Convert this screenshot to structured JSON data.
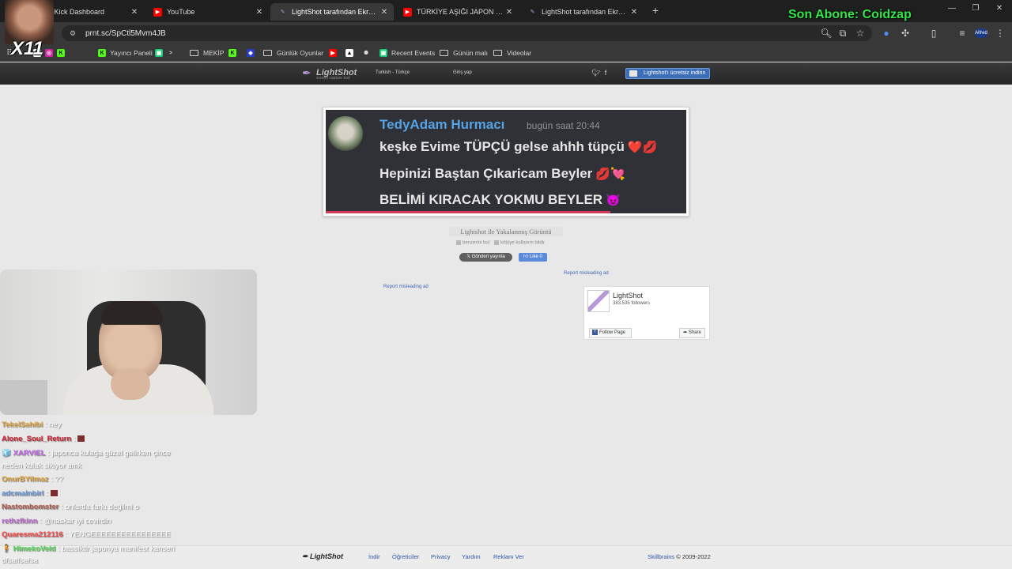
{
  "browser": {
    "tabs": [
      {
        "label": "m - Kick Dashboard",
        "favicon_color": "#53fc18"
      },
      {
        "label": "YouTube",
        "favicon_color": "#ff0000"
      },
      {
        "label": "LightShot tarafından Ekran Gör",
        "favicon_color": "#9b7bc9",
        "active": true
      },
      {
        "label": "TÜRKİYE AŞIĞI JAPON KADINL/",
        "favicon_color": "#ff0000"
      },
      {
        "label": "LightShot tarafından Ekran Gör",
        "favicon_color": "#9b7bc9"
      }
    ],
    "new_tab": "+",
    "window_controls": {
      "minimize": "—",
      "maximize": "❐",
      "close": "✕"
    },
    "address_url": "prnt.sc/SpCtl5Mvm4JB",
    "bookmarks": [
      {
        "label": "Yayıncı Paneli",
        "icon_color": "#53fc18"
      },
      {
        "label": "MEKİP",
        "icon_color": "#cfcfcf",
        "folder": true
      },
      {
        "label": "Günlük Oyunlar",
        "folder": true
      },
      {
        "label": "Recent Events",
        "icon_color": "#1ec97a"
      },
      {
        "label": "Günün malı",
        "folder": true
      },
      {
        "label": "Videolar",
        "folder": true
      }
    ],
    "extension_badge": "Alfred"
  },
  "overlay": {
    "subscriber_text": "Son Abone: Coidzap",
    "combo_text": "X11"
  },
  "lightshot": {
    "logo": "LightShot",
    "tagline": "screen capture tool",
    "language": "Turkish - Türkçe",
    "login": "Giriş yap",
    "download_button": "Lightshot'ı ücretsiz indirin",
    "screenshot": {
      "username": "TedyAdam Hurmacı",
      "timestamp": "bugün saat 20:44",
      "lines": [
        {
          "text": "keşke Evime TÜPÇÜ gelse ahhh tüpçü",
          "emoji": "❤️💋"
        },
        {
          "text": "Hepinizi Baştan Çıkaricam Beyler",
          "emoji": "💋💘"
        },
        {
          "text": "BELİMİ KIRACAK YOKMU BEYLER",
          "emoji": "😈"
        }
      ]
    },
    "caption": "Lightshot ile Yakalanmış Görüntü",
    "find_similar": "benzerini bul",
    "report_abuse": "kötüye kullanım bildir",
    "tweet_button": "Gönderi yayınla",
    "like_button": "Like 0",
    "report_ad_left": "Report misleading ad",
    "report_ad_right": "Report misleading ad",
    "fb_widget": {
      "name": "LightShot",
      "followers": "383,535 followers",
      "follow": "Follow Page",
      "share": "Share"
    },
    "footer": {
      "logo": "LightShot",
      "links": [
        "İndir",
        "Öğreticiler",
        "Privacy",
        "Yardım",
        "Reklam Ver"
      ],
      "copyright_brand": "Skillbrains",
      "copyright_rest": " © 2009-2022"
    }
  },
  "chat": [
    {
      "user": "TekelSahibi",
      "color": "#e3a73c",
      "text": ": ney"
    },
    {
      "user": "Alone_Soul_Return",
      "color": "#d11d2d",
      "text": ":",
      "badge": true
    },
    {
      "user": "XARVIEL",
      "color": "#c168e8",
      "text": ": japonca kulağa güzel gelirken çince"
    },
    {
      "user": "",
      "color": "#ffffff",
      "text": "neden kulak sikiyor amk"
    },
    {
      "user": "OnurBYilmaz",
      "color": "#e3a73c",
      "text": ": ??"
    },
    {
      "user": "adcmalnbirl",
      "color": "#6c9bd8",
      "text": ":",
      "badge": true
    },
    {
      "user": "Nastombomster",
      "color": "#b4584b",
      "text": ": onlarda farkı değilmi o"
    },
    {
      "user": "rethzfkinn",
      "color": "#c46ad8",
      "text": ": @naskar iyi cevirdin"
    },
    {
      "user": "Quaresma212116",
      "color": "#ff4646",
      "text": ": YENGEEEEEEEEEEEEEEEE"
    },
    {
      "user": "HimekoVeld",
      "color": "#59e25c",
      "text": ": bassiktir japonya manifest kanseri"
    },
    {
      "user": "",
      "color": "#ffffff",
      "text": "dfsaffsafsa"
    }
  ]
}
